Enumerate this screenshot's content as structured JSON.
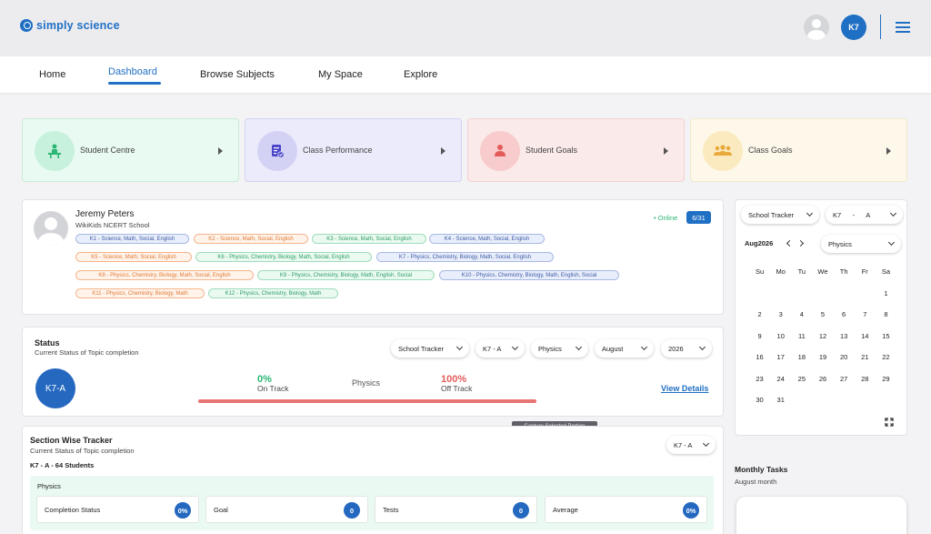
{
  "app": {
    "logo_text": "simply science"
  },
  "header": {
    "avatar_initials": "K7",
    "menu_icon": "hamburger-menu-icon"
  },
  "nav": {
    "items": [
      "Home",
      "Dashboard",
      "Browse Subjects",
      "My Space",
      "Explore"
    ],
    "active": "Dashboard"
  },
  "tiles": [
    {
      "label": "Student Centre",
      "icon": "desk-student-icon",
      "bg": "#e8faf1",
      "border": "#c7ecd9",
      "icon_bg": "#c8f1dd",
      "icon_color": "#2bb673"
    },
    {
      "label": "Class Performance",
      "icon": "performance-doc-icon",
      "bg": "#ebebfb",
      "border": "#d3d3f1",
      "icon_bg": "#d3d2f5",
      "icon_color": "#4b45c9"
    },
    {
      "label": "Student Goals",
      "icon": "student-goal-icon",
      "bg": "#fbeaea",
      "border": "#f1d2d2",
      "icon_bg": "#f8cccc",
      "icon_color": "#e45b5b"
    },
    {
      "label": "Class Goals",
      "icon": "class-group-icon",
      "bg": "#fdf8ea",
      "border": "#f1e8cc",
      "icon_bg": "#fbeabf",
      "icon_color": "#e8a83a"
    }
  ],
  "profile": {
    "name": "Jeremy Peters",
    "school": "WikiKids NCERT School",
    "status": "Online",
    "count": "6/31",
    "chips": [
      {
        "text": "K1 - Science,  Math,  Social, English",
        "color": "blue"
      },
      {
        "text": "K2 - Science,  Math,  Social, English",
        "color": "orange"
      },
      {
        "text": "K3 - Science,  Math,  Social, English",
        "color": "green"
      },
      {
        "text": "K4 - Science,  Math,  Social, English",
        "color": "blue"
      },
      {
        "text": "K5 - Science,  Math,  Social, English",
        "color": "orange"
      },
      {
        "text": "K6 - Physics,  Chemistry,  Biology,  Math,  Social, English",
        "color": "green"
      },
      {
        "text": "K7 - Physics,  Chemistry,  Biology,  Math,  Social, English",
        "color": "blue"
      },
      {
        "text": "K8 - Physics,  Chemistry,  Biology,  Math,  Social, English",
        "color": "orange"
      },
      {
        "text": "K9 - Physics,  Chemistry,  Biology,  Math,  English, Social",
        "color": "green"
      },
      {
        "text": "K10 - Physics,  Chemistry,  Biology,  Math,  English, Social",
        "color": "blue"
      },
      {
        "text": "K11 - Physics,  Chemistry,  Biology, Math",
        "color": "orange"
      },
      {
        "text": "K12 - Physics,  Chemistry,  Biology, Math",
        "color": "green"
      }
    ]
  },
  "status": {
    "title": "Status",
    "subtitle": "Current Status of Topic completion",
    "filters": [
      "School Tracker",
      "K7 - A",
      "Physics",
      "August",
      "2026"
    ],
    "class_label": "K7-A",
    "on_track_pct": "0%",
    "on_track_label": "On Track",
    "subject": "Physics",
    "off_track_pct": "100%",
    "off_track_label": "Off Track",
    "off_track_fraction": 1.0,
    "view_details": "View Details"
  },
  "tooltip": "Capture Selected Portion",
  "section_tracker": {
    "title": "Section Wise Tracker",
    "subtitle": "Current Status of Topic completion",
    "class_select": "K7 - A",
    "class_info": "K7 - A - 64 Students",
    "subject": "Physics",
    "metrics": [
      {
        "label": "Completion Status",
        "value": "0%"
      },
      {
        "label": "Goal",
        "value": "0"
      },
      {
        "label": "Tests",
        "value": "0"
      },
      {
        "label": "Average",
        "value": "0%"
      }
    ]
  },
  "calendar": {
    "tracker_select": "School Tracker",
    "class_select": "K7      -      A",
    "month": "Aug2026",
    "subject_select": "Physics",
    "weekdays": [
      "Su",
      "Mo",
      "Tu",
      "We",
      "Th",
      "Fr",
      "Sa"
    ],
    "weeks": [
      [
        "",
        "",
        "",
        "",
        "",
        "",
        "1"
      ],
      [
        "2",
        "3",
        "4",
        "5",
        "6",
        "7",
        "8"
      ],
      [
        "9",
        "10",
        "11",
        "12",
        "13",
        "14",
        "15"
      ],
      [
        "16",
        "17",
        "18",
        "19",
        "20",
        "21",
        "22"
      ],
      [
        "23",
        "24",
        "25",
        "26",
        "27",
        "28",
        "29"
      ],
      [
        "30",
        "31",
        "",
        "",
        "",
        "",
        ""
      ]
    ]
  },
  "monthly_tasks": {
    "title": "Monthly Tasks",
    "subtitle": "August month"
  }
}
